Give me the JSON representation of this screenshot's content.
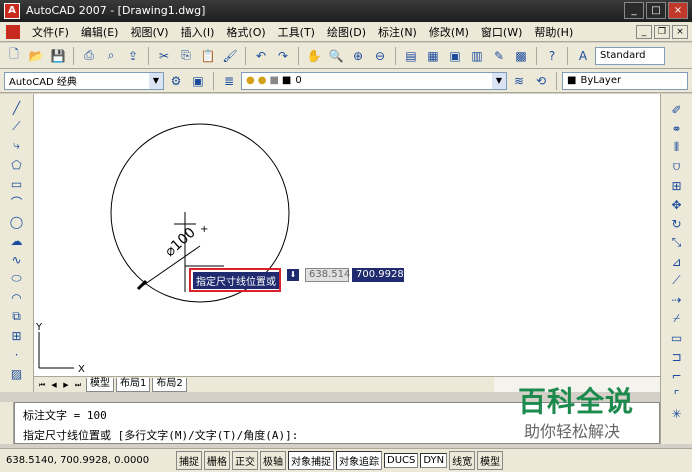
{
  "window": {
    "title": "AutoCAD 2007 - [Drawing1.dwg]",
    "minimize": "_",
    "maximize": "□",
    "close": "×"
  },
  "menu": [
    "文件(F)",
    "编辑(E)",
    "视图(V)",
    "插入(I)",
    "格式(O)",
    "工具(T)",
    "绘图(D)",
    "标注(N)",
    "修改(M)",
    "窗口(W)",
    "帮助(H)"
  ],
  "mdi": {
    "minimize": "_",
    "restore": "❐",
    "close": "×"
  },
  "toolbar": {
    "text_style": "Standard",
    "workspace": "AutoCAD 经典",
    "layer": "0",
    "color": "ByLayer"
  },
  "drawing": {
    "dimension_text": "⌀100",
    "hud_prompt": "指定尺寸线位置或",
    "hud_value_1": "638.514",
    "hud_value_2": "700.9928",
    "ucs_x": "X",
    "ucs_y": "Y"
  },
  "layout_tabs": [
    "模型",
    "布局1",
    "布局2"
  ],
  "command": {
    "line1": "标注文字 = 100",
    "line2": "指定尺寸线位置或 [多行文字(M)/文字(T)/角度(A)]:"
  },
  "status": {
    "coords": "638.5140,  700.9928,  0.0000",
    "buttons": [
      "捕捉",
      "栅格",
      "正交",
      "极轴",
      "对象捕捉",
      "对象追踪",
      "DUCS",
      "DYN",
      "线宽",
      "模型"
    ]
  },
  "watermark": {
    "title": "百科全说",
    "subtitle": "助你轻松解决"
  },
  "colors": {
    "dim_red": "#d9232c",
    "hud_blue": "#1f2b6e",
    "watermark_green": "#1b8a4c"
  }
}
